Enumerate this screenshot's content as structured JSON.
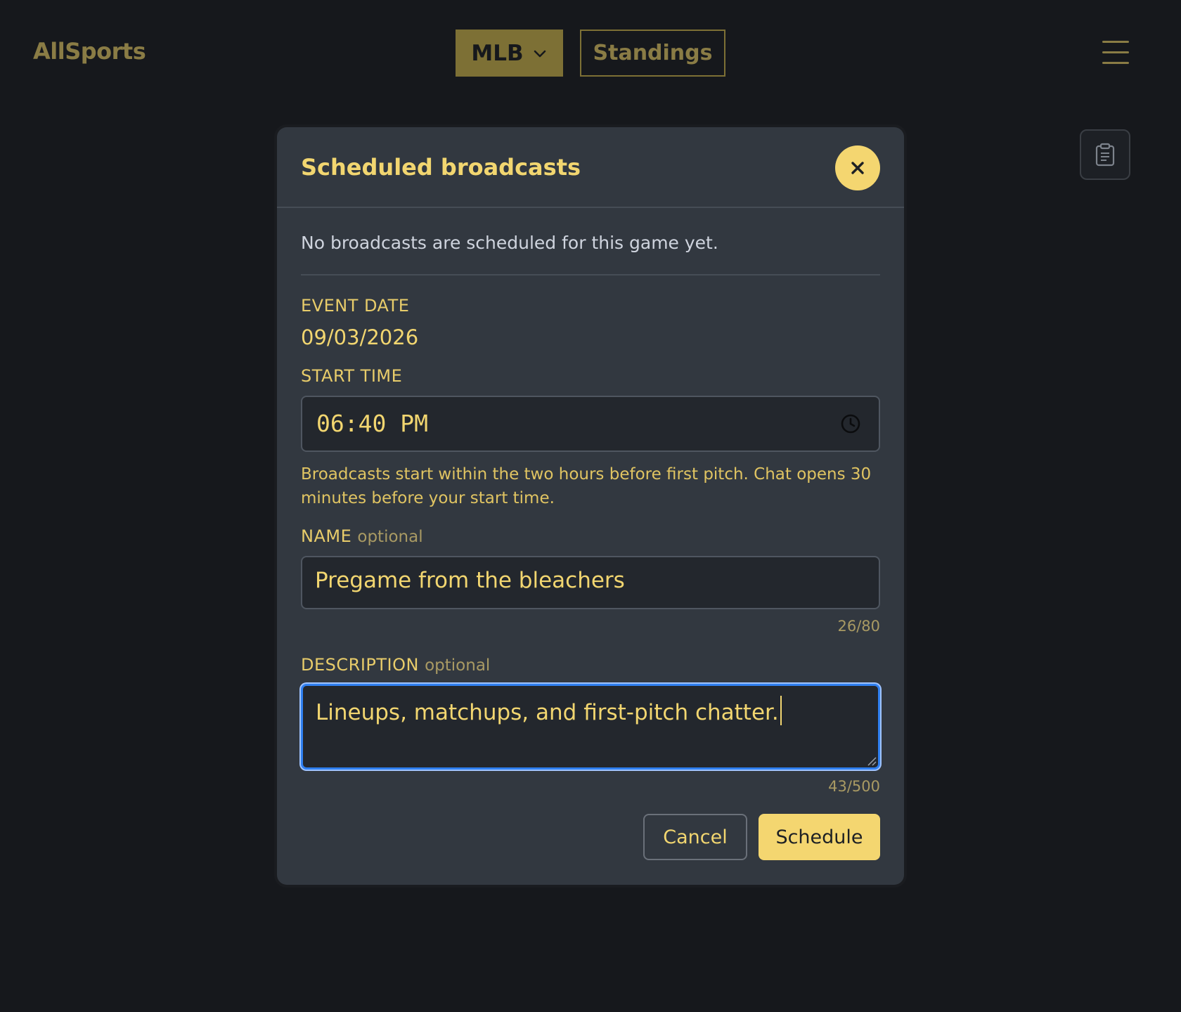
{
  "topbar": {
    "logo": "AllSports",
    "league_label": "MLB",
    "league_icon": "chevron-down-icon",
    "standings_label": "Standings",
    "menu_icon": "hamburger-icon"
  },
  "side_tool": {
    "icon": "clipboard-icon"
  },
  "modal": {
    "title": "Scheduled broadcasts",
    "close_icon": "close-icon",
    "empty_message": "No broadcasts are scheduled for this game yet.",
    "event_date_label": "EVENT DATE",
    "event_date_value": "09/03/2026",
    "start_time_label": "START TIME",
    "start_time_value": "06:40 PM",
    "start_time_icon": "clock-icon",
    "hint": "Broadcasts start within the two hours before first pitch. Chat opens 30 minutes before your start time.",
    "name_label": "NAME",
    "name_optional": "optional",
    "name_value": "Pregame from the bleachers",
    "name_counter": "26/80",
    "description_label": "DESCRIPTION",
    "description_optional": "optional",
    "description_value": "Lineups, matchups, and first-pitch chatter.",
    "description_counter": "43/500",
    "cancel_label": "Cancel",
    "schedule_label": "Schedule"
  },
  "colors": {
    "background": "#16181c",
    "modal": "#323840",
    "accent": "#f4d670",
    "focus": "#2f7ff0"
  }
}
